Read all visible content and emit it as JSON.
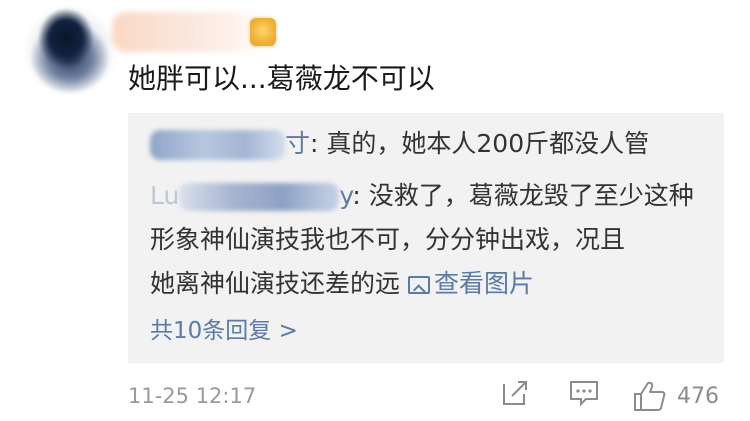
{
  "comment": {
    "text": "她胖可以...葛薇龙不可以",
    "time": "11-25 12:17",
    "like_count": "476"
  },
  "replies": [
    {
      "name_suffix": "寸",
      "text": ": 真的，她本人200斤都没人管"
    },
    {
      "name_prefix": "Lu",
      "name_suffix": "y",
      "text_line1": ": 没救了，葛薇龙毁了至少这种",
      "text_line2": "形象神仙演技我也不可，分分钟出戏，况且",
      "text_line3": "她离神仙演技还差的远 ",
      "picture_link": "查看图片"
    }
  ],
  "more_replies": "共10条回复 >",
  "icons": {
    "share": "share-icon",
    "comment": "comment-icon",
    "like": "thumbs-up-icon",
    "picture": "image-icon"
  },
  "colors": {
    "link": "#5a7aa8",
    "reply_bg": "#f2f2f2",
    "text": "#1a1a1a",
    "meta": "#9a9a9a"
  }
}
